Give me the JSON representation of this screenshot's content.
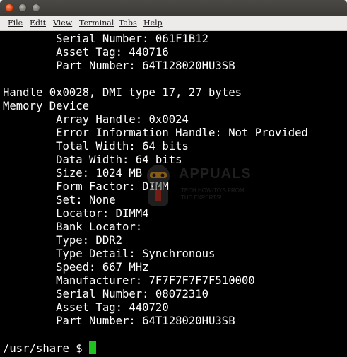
{
  "window": {
    "controls": [
      "close",
      "minimize",
      "maximize"
    ]
  },
  "menu": [
    "File",
    "Edit",
    "View",
    "Terminal",
    "Tabs",
    "Help"
  ],
  "terminal": {
    "lines": [
      "        Serial Number: 061F1B12",
      "        Asset Tag: 440716",
      "        Part Number: 64T128020HU3SB",
      "",
      "Handle 0x0028, DMI type 17, 27 bytes",
      "Memory Device",
      "        Array Handle: 0x0024",
      "        Error Information Handle: Not Provided",
      "        Total Width: 64 bits",
      "        Data Width: 64 bits",
      "        Size: 1024 MB",
      "        Form Factor: DIMM",
      "        Set: None",
      "        Locator: DIMM4",
      "        Bank Locator:",
      "        Type: DDR2",
      "        Type Detail: Synchronous",
      "        Speed: 667 MHz",
      "        Manufacturer: 7F7F7F7F7F510000",
      "        Serial Number: 08072310",
      "        Asset Tag: 440720",
      "        Part Number: 64T128020HU3SB",
      ""
    ],
    "prompt": "/usr/share $ ",
    "cursor_color": "#1fc21f",
    "foreground": "#ffffff",
    "background": "#000000"
  },
  "watermark": {
    "title": "APPUALS",
    "line1": "TECH HOW-TO'S FROM",
    "line2": "THE EXPERTS!"
  }
}
